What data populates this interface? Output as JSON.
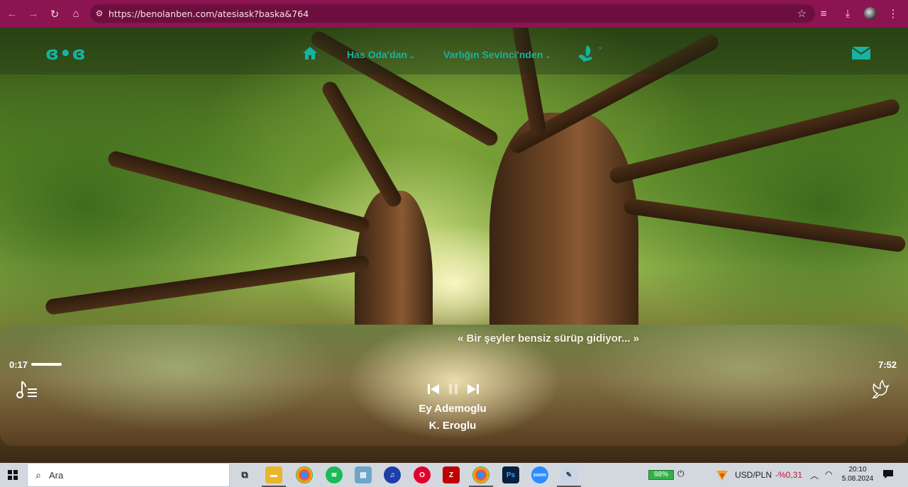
{
  "browser": {
    "url": "https://benolanben.com/atesiask?baska&764",
    "back_label": "←",
    "forward_label": "→",
    "reload_label": "↻",
    "home_label": "⌂",
    "star_label": "☆",
    "media_label": "≡",
    "download_label": "⤓",
    "menu_label": "⋮"
  },
  "site": {
    "logo": "ɞ•ɞ",
    "nav": [
      {
        "label": "Has Oda'dan",
        "chevron": "⌄"
      },
      {
        "label": "Varlığın Sevinci'nden",
        "chevron": "⌄"
      }
    ],
    "leaf_chevron": "⌄",
    "accent": "#16b3a3"
  },
  "player": {
    "quote": "« Bir şeyler bensiz sürüp gidiyor... »",
    "elapsed": "0:17",
    "duration": "7:52",
    "progress": 0.036,
    "title": "Ey Ademoglu",
    "artist": "K. Eroglu"
  },
  "taskbar": {
    "search_placeholder": "Ara",
    "battery": "98%",
    "currency_pair": "USD/PLN",
    "currency_change": "-%0,31",
    "time": "20:10",
    "date": "5.08.2024",
    "apps": [
      "task-view",
      "file-explorer",
      "chrome",
      "spotify",
      "notes",
      "audio",
      "opera",
      "filezilla",
      "chrome-profile",
      "photoshop",
      "zoom",
      "paint"
    ]
  }
}
